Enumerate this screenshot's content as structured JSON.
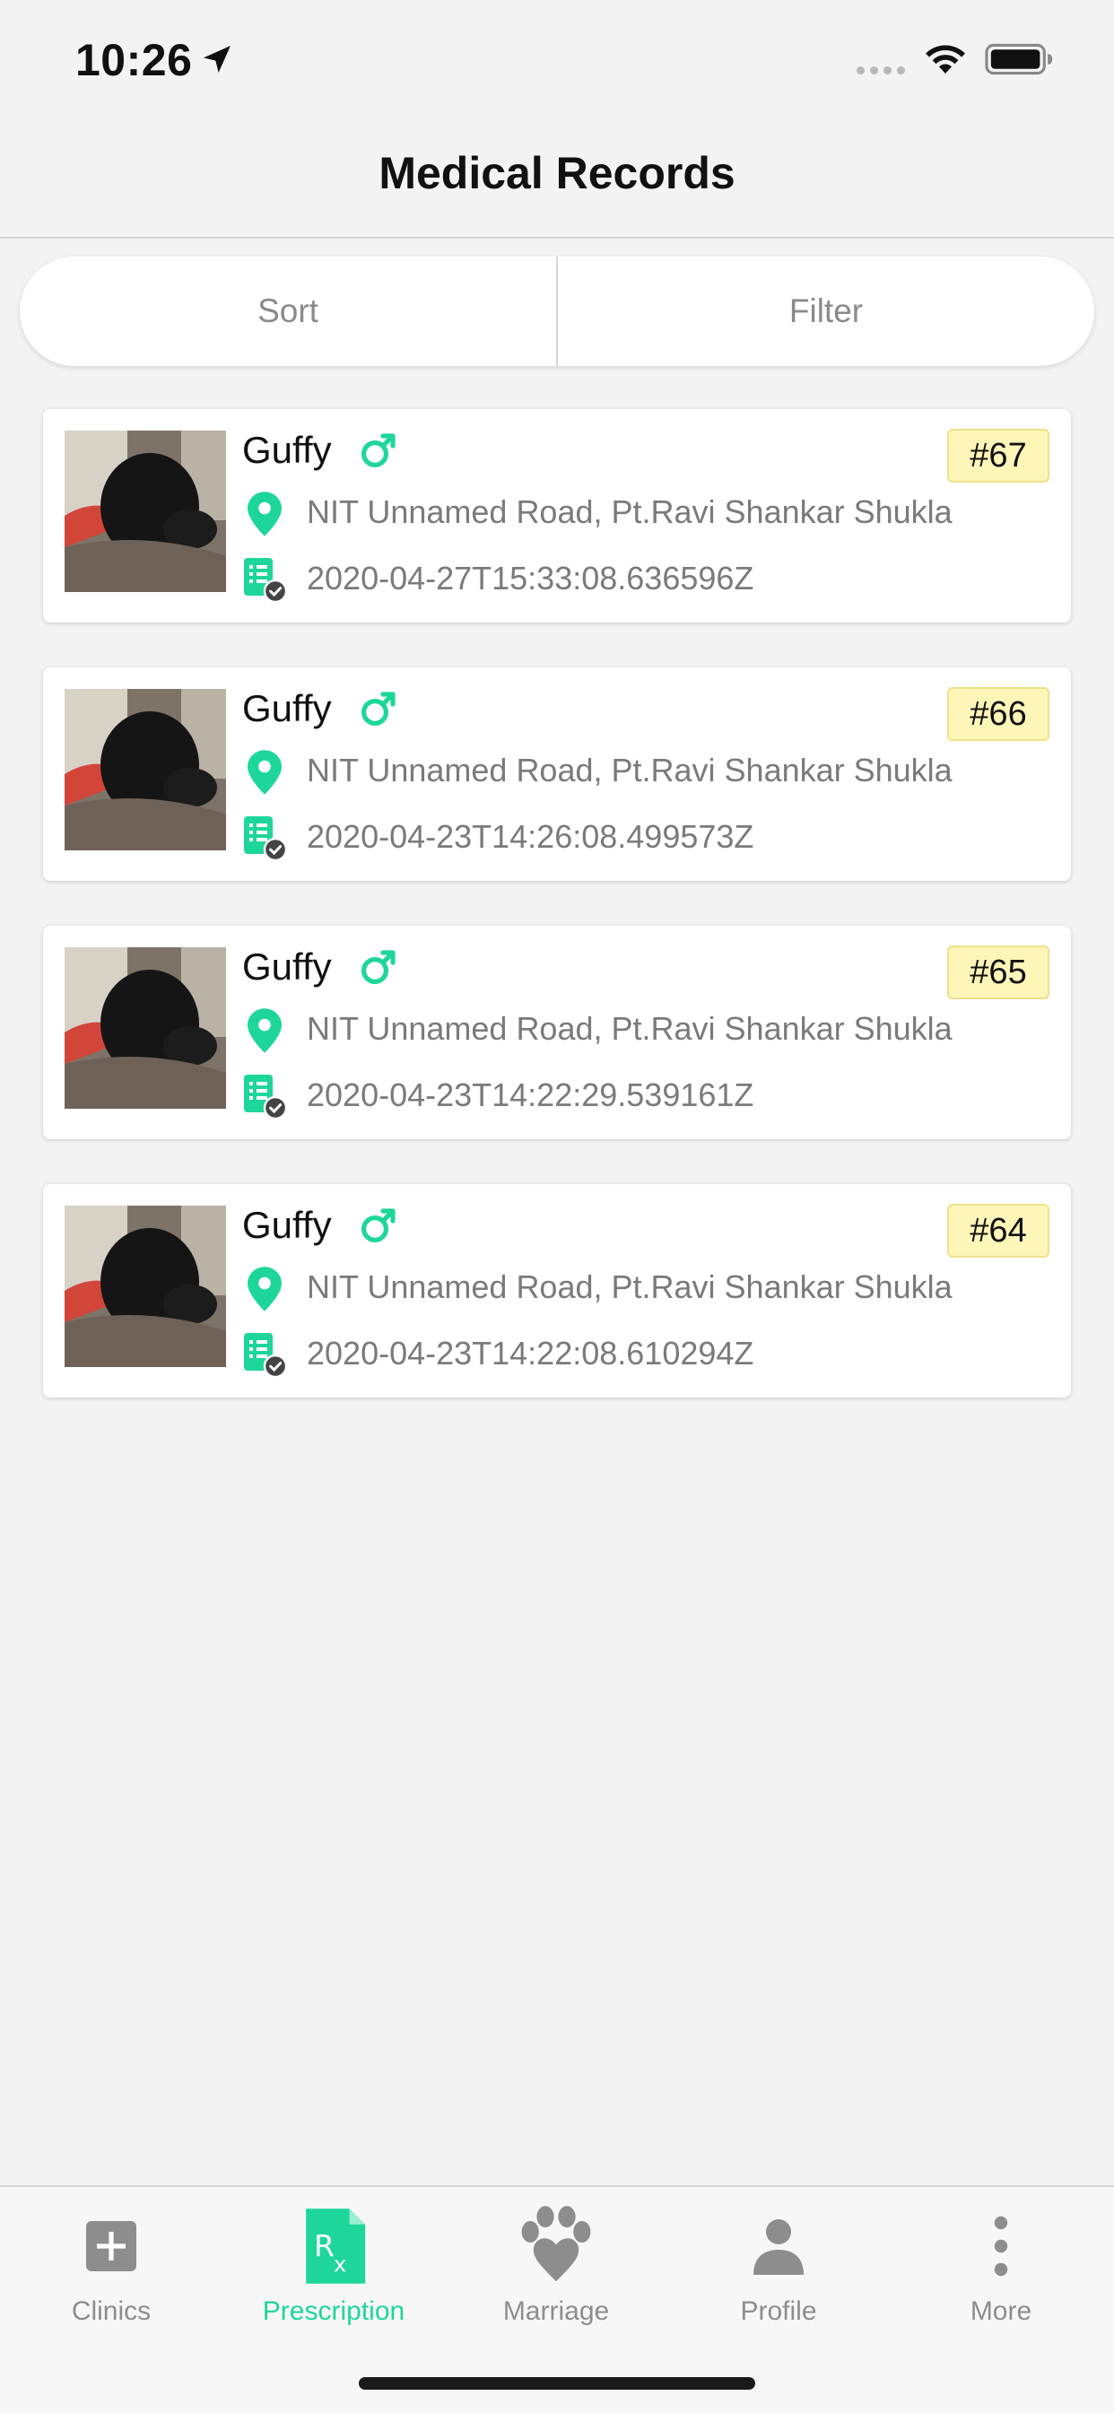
{
  "status_bar": {
    "time": "10:26"
  },
  "nav": {
    "title": "Medical Records"
  },
  "toolbar": {
    "sort_label": "Sort",
    "filter_label": "Filter"
  },
  "records": [
    {
      "name": "Guffy",
      "id": "#67",
      "address": "NIT Unnamed Road, Pt.Ravi Shankar Shukla",
      "timestamp": "2020-04-27T15:33:08.636596Z"
    },
    {
      "name": "Guffy",
      "id": "#66",
      "address": "NIT Unnamed Road, Pt.Ravi Shankar Shukla",
      "timestamp": "2020-04-23T14:26:08.499573Z"
    },
    {
      "name": "Guffy",
      "id": "#65",
      "address": "NIT Unnamed Road, Pt.Ravi Shankar Shukla",
      "timestamp": "2020-04-23T14:22:29.539161Z"
    },
    {
      "name": "Guffy",
      "id": "#64",
      "address": "NIT Unnamed Road, Pt.Ravi Shankar Shukla",
      "timestamp": "2020-04-23T14:22:08.610294Z"
    }
  ],
  "tabs": [
    {
      "label": "Clinics",
      "icon": "plus-square-icon",
      "active": false
    },
    {
      "label": "Prescription",
      "icon": "rx-document-icon",
      "active": true
    },
    {
      "label": "Marriage",
      "icon": "paw-icon",
      "active": false
    },
    {
      "label": "Profile",
      "icon": "person-icon",
      "active": false
    },
    {
      "label": "More",
      "icon": "more-vertical-icon",
      "active": false
    }
  ],
  "colors": {
    "accent": "#1ed69a",
    "badge_bg": "#fdf6b8",
    "text_muted": "#7a7a7a"
  }
}
